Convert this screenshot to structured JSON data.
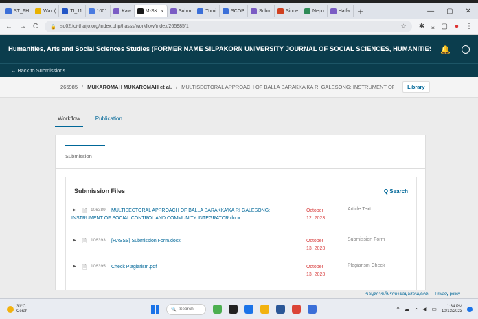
{
  "browser": {
    "tabs": [
      {
        "label": "ST_FH",
        "color": "#3b6fd8"
      },
      {
        "label": "Wax (",
        "color": "#e8b100"
      },
      {
        "label": "TI_11",
        "color": "#2356c7"
      },
      {
        "label": "1001",
        "color": "#4a7be0"
      },
      {
        "label": "Kaw",
        "color": "#7a5cc4"
      },
      {
        "label": "M-SK",
        "color": "#1a1a1a",
        "active": true
      },
      {
        "label": "Subm",
        "color": "#7a5cc4"
      },
      {
        "label": "Turni",
        "color": "#3b6fd8"
      },
      {
        "label": "SCOP",
        "color": "#3b6fd8"
      },
      {
        "label": "Subm",
        "color": "#7a5cc4"
      },
      {
        "label": "Sinde",
        "color": "#d04020"
      },
      {
        "label": "Nepo",
        "color": "#2e8b57"
      },
      {
        "label": "Halfw",
        "color": "#7a5cc4"
      }
    ],
    "new_tab": "+",
    "url": "so02.tci-thaijo.org/index.php/hasss/workflow/index/265985/1"
  },
  "header": {
    "journal_title": "Humanities, Arts and Social Sciences Studies (FORMER NAME SILPAKORN UNIVERSITY JOURNAL OF SOCIAL SCIENCES, HUMANITIES, AND A..."
  },
  "backbar": {
    "label": "← Back to Submissions"
  },
  "titlebar": {
    "submission_id": "265985",
    "separator": "/",
    "author": "MUKAROMAH MUKAROMAH et al.",
    "title": "MULTISECTORAL APPROACH OF BALLA BARAKKA'KA RI GALESONG: INSTRUMENT OF SC",
    "library": "Library"
  },
  "workflow": {
    "tabs": [
      "Workflow",
      "Publication"
    ],
    "stage": "Submission"
  },
  "files": {
    "heading": "Submission Files",
    "search": "Q Search",
    "rows": [
      {
        "id": "106389",
        "name": "MULTISECTORAL APPROACH OF BALLA BARAKKA'KA RI GALESONG: INSTRUMENT OF SOCIAL CONTROL AND COMMUNITY INTEGRATOR.docx",
        "date": "October 12, 2023",
        "type": "Article Text"
      },
      {
        "id": "106393",
        "name": "[HASSS] Submission Form.docx",
        "date": "October 13, 2023",
        "type": "Submission Form"
      },
      {
        "id": "106395",
        "name": "Check Plagiarism.pdf",
        "date": "October 13, 2023",
        "type": "Plagiarism Check"
      }
    ]
  },
  "footer": {
    "privacy_thai": "ข้อมูลการเก็บรักษาข้อมูลส่วนบุคคล",
    "privacy": "Privacy policy"
  },
  "taskbar": {
    "temp": "31°C",
    "weather": "Cerah",
    "search": "Search",
    "time": "1:34 PM",
    "date": "10/13/2023"
  }
}
